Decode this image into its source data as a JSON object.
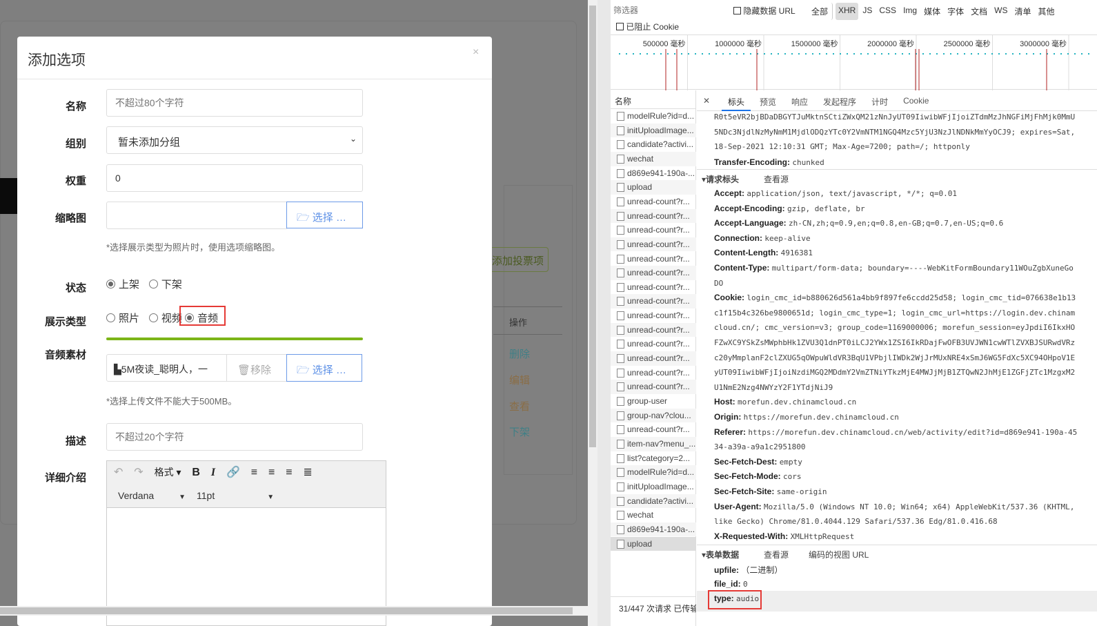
{
  "background": {
    "add_vote_item": "添加投票项",
    "ops_header": "操作",
    "ops": [
      "删除",
      "编辑",
      "查看",
      "下架"
    ],
    "ops_colors": [
      "#3a7a80",
      "#8a6a40",
      "#8a6a40",
      "#3a7a80"
    ]
  },
  "modal": {
    "title": "添加选项",
    "close": "×",
    "name": {
      "label": "名称",
      "placeholder": "不超过80个字符"
    },
    "group": {
      "label": "组别",
      "value": "暂未添加分组"
    },
    "weight": {
      "label": "权重",
      "value": "0"
    },
    "thumb": {
      "label": "缩略图",
      "button": "选择 …",
      "hint": "*选择展示类型为照片时，使用选项缩略图。"
    },
    "status": {
      "label": "状态",
      "options": [
        "上架",
        "下架"
      ],
      "selected": 0
    },
    "display": {
      "label": "展示类型",
      "options": [
        "照片",
        "视频",
        "音频"
      ],
      "selected": 2
    },
    "progress": 100,
    "audio": {
      "label": "音频素材",
      "file": "5M夜读_聪明人，一",
      "remove": "移除",
      "button": "选择 …",
      "hint": "*选择上传文件不能大于500MB。"
    },
    "desc": {
      "label": "描述",
      "placeholder": "不超过20个字符"
    },
    "detail": {
      "label": "详细介绍",
      "format": "格式",
      "font": "Verdana",
      "size": "11pt"
    }
  },
  "devtools": {
    "filter_placeholder": "筛选器",
    "hide_data_url": "隐藏数据 URL",
    "types": [
      "全部",
      "XHR",
      "JS",
      "CSS",
      "Img",
      "媒体",
      "字体",
      "文档",
      "WS",
      "清单",
      "其他"
    ],
    "active_type": "XHR",
    "blocked_cookies": "已阻止 Cookie",
    "timeline_ticks": [
      "500000 毫秒",
      "1000000 毫秒",
      "1500000 毫秒",
      "2000000 毫秒",
      "2500000 毫秒",
      "3000000 毫秒"
    ],
    "name_header": "名称",
    "requests": [
      "modelRule?id=d...",
      "initUploadImage...",
      "candidate?activi...",
      "wechat",
      "d869e941-190a-...",
      "upload",
      "unread-count?r...",
      "unread-count?r...",
      "unread-count?r...",
      "unread-count?r...",
      "unread-count?r...",
      "unread-count?r...",
      "unread-count?r...",
      "unread-count?r...",
      "unread-count?r...",
      "unread-count?r...",
      "unread-count?r...",
      "unread-count?r...",
      "unread-count?r...",
      "unread-count?r...",
      "group-user",
      "group-nav?clou...",
      "unread-count?r...",
      "item-nav?menu_...",
      "list?category=2...",
      "modelRule?id=d...",
      "initUploadImage...",
      "candidate?activi...",
      "wechat",
      "d869e941-190a-...",
      "upload"
    ],
    "selected_request": 30,
    "status_bar": "31/447 次请求  已传输",
    "tabs": [
      "标头",
      "预览",
      "响应",
      "发起程序",
      "计时",
      "Cookie"
    ],
    "active_tab": "标头",
    "resp_cont": [
      "R0t5eVR2bjBDaDBGYTJuMktnSCtiZWxQM21zNnJyUT09IiwibWFjIjoiZTdmMzJhNGFiMjFhMjk0MmU",
      "5NDc3NjdlNzMyNmM1MjdlODQzYTc0Y2VmNTM1NGQ4Mzc5YjU3NzJlNDNkMmYyOCJ9; expires=Sat,",
      "18-Sep-2021 12:10:31 GMT; Max-Age=7200; path=/; httponly"
    ],
    "transfer_encoding": {
      "k": "Transfer-Encoding:",
      "v": "chunked"
    },
    "req_section": {
      "title": "请求标头",
      "view_source": "查看源"
    },
    "req_headers": [
      {
        "k": "Accept:",
        "v": "application/json, text/javascript, */*; q=0.01"
      },
      {
        "k": "Accept-Encoding:",
        "v": "gzip, deflate, br"
      },
      {
        "k": "Accept-Language:",
        "v": "zh-CN,zh;q=0.9,en;q=0.8,en-GB;q=0.7,en-US;q=0.6"
      },
      {
        "k": "Connection:",
        "v": "keep-alive"
      },
      {
        "k": "Content-Length:",
        "v": "4916381"
      },
      {
        "k": "Content-Type:",
        "v": "multipart/form-data; boundary=----WebKitFormBoundary11WOuZgbXuneGo"
      },
      {
        "k": "",
        "v": "DO"
      },
      {
        "k": "Cookie:",
        "v": "login_cmc_id=b880626d561a4bb9f897fe6ccdd25d58; login_cmc_tid=076638e1b13"
      },
      {
        "k": "",
        "v": "c1f15b4c326be9800651d; login_cmc_type=1; login_cmc_url=https://login.dev.chinam"
      },
      {
        "k": "",
        "v": "cloud.cn/; cmc_version=v3; group_code=1169000006; morefun_session=eyJpdiI6IkxHO"
      },
      {
        "k": "",
        "v": "FZwXC9YSkZsMWphbHk1ZVU3Q1dnPT0iLCJ2YWx1ZSI6IkRDajFwOFB3UVJWN1cwWTlZVXBJSURwdVRz"
      },
      {
        "k": "",
        "v": "c20yMmplanF2clZXUG5qOWpuWldVR3BqU1VPbjlIWDk2WjJrMUxNRE4xSmJ6WG5FdXc5XC94OHpoV1E"
      },
      {
        "k": "",
        "v": "yUT09IiwibWFjIjoiNzdiMGQ2MDdmY2VmZTNiYTkzMjE4MWJjMjB1ZTQwN2JhMjE1ZGFjZTc1MzgxM2"
      },
      {
        "k": "",
        "v": "U1NmE2Nzg4NWYzY2F1YTdjNiJ9"
      },
      {
        "k": "Host:",
        "v": "morefun.dev.chinamcloud.cn"
      },
      {
        "k": "Origin:",
        "v": "https://morefun.dev.chinamcloud.cn"
      },
      {
        "k": "Referer:",
        "v": "https://morefun.dev.chinamcloud.cn/web/activity/edit?id=d869e941-190a-45"
      },
      {
        "k": "",
        "v": "34-a39a-a9a1c2951800"
      },
      {
        "k": "Sec-Fetch-Dest:",
        "v": "empty"
      },
      {
        "k": "Sec-Fetch-Mode:",
        "v": "cors"
      },
      {
        "k": "Sec-Fetch-Site:",
        "v": "same-origin"
      },
      {
        "k": "User-Agent:",
        "v": "Mozilla/5.0 (Windows NT 10.0; Win64; x64) AppleWebKit/537.36 (KHTML,"
      },
      {
        "k": "",
        "v": "like Gecko) Chrome/81.0.4044.129 Safari/537.36 Edg/81.0.416.68"
      },
      {
        "k": "X-Requested-With:",
        "v": "XMLHttpRequest"
      }
    ],
    "form_section": {
      "title": "表单数据",
      "view_source": "查看源",
      "view_url": "编码的视图 URL"
    },
    "form_data": [
      {
        "k": "upfile:",
        "v": "（二进制）"
      },
      {
        "k": "file_id:",
        "v": "0"
      },
      {
        "k": "type:",
        "v": "audio"
      }
    ],
    "highlight_color": "#e53935"
  }
}
